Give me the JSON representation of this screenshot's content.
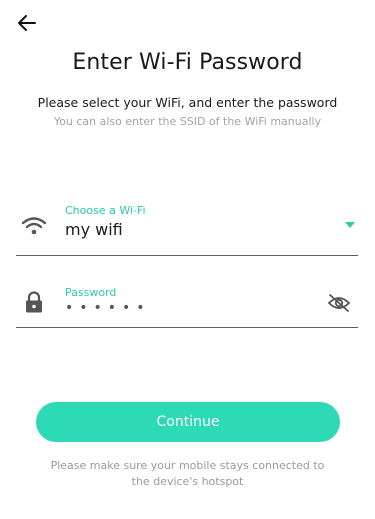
{
  "header": {
    "back_icon": "arrow-left-icon",
    "title": "Enter Wi-Fi Password",
    "subtitle": "Please select your WiFi, and enter the password",
    "hint": "You can also enter the SSID of the WiFi manually"
  },
  "wifi_field": {
    "icon": "wifi-icon",
    "label": "Choose a Wi-Fi",
    "value": "my wifi",
    "dropdown_icon": "caret-down-icon"
  },
  "password_field": {
    "icon": "lock-icon",
    "label": "Password",
    "masked_value": "••••••",
    "visibility_icon": "eye-off-icon"
  },
  "continue_label": "Continue",
  "footer_note": "Please make sure your mobile stays connected to the device's hotspot",
  "colors": {
    "accent": "#2ed9b5",
    "label_accent": "#2ec9a9",
    "text": "#1a1a1a",
    "muted": "#a3a3a3"
  }
}
